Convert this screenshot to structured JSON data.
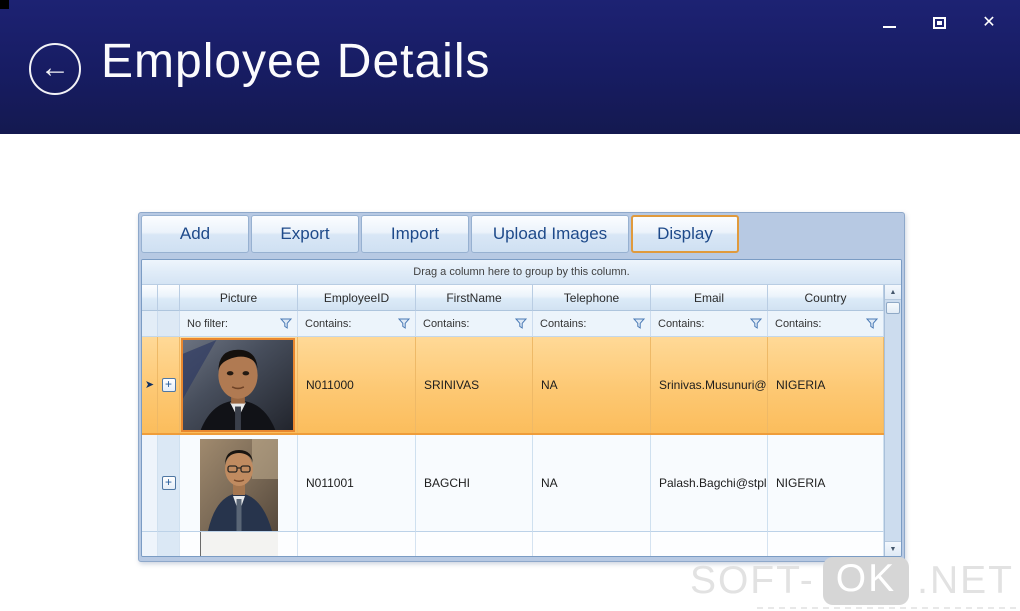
{
  "window": {
    "title": "Employee Details",
    "controls": {
      "close": "✕"
    }
  },
  "toolbar": {
    "buttons": [
      {
        "label": "Add"
      },
      {
        "label": "Export"
      },
      {
        "label": "Import"
      },
      {
        "label": "Upload Images"
      },
      {
        "label": "Display",
        "focused": true
      }
    ]
  },
  "grid": {
    "group_hint": "Drag a column here to group by this column.",
    "columns": [
      "Picture",
      "EmployeeID",
      "FirstName",
      "Telephone",
      "Email",
      "Country"
    ],
    "filters": [
      "No filter:",
      "Contains:",
      "Contains:",
      "Contains:",
      "Contains:",
      "Contains:"
    ],
    "rows": [
      {
        "picture": "portrait-man-dark-suit",
        "employee_id": "N011000",
        "first_name": "SRINIVAS",
        "telephone": "NA",
        "email": "Srinivas.Musunuri@s...",
        "country": "NIGERIA",
        "selected": true
      },
      {
        "picture": "portrait-man-glasses-navy-suit",
        "employee_id": "N011001",
        "first_name": "BAGCHI",
        "telephone": "NA",
        "email": "Palash.Bagchi@stplg...",
        "country": "NIGERIA",
        "selected": false
      }
    ],
    "partial_row_visible": true
  },
  "watermark": {
    "prefix": "SOFT-",
    "badge": "OK",
    "suffix": ".NET"
  },
  "colors": {
    "header_navy": "#171c62",
    "panel_blue": "#b7c9e3",
    "selected_row_orange": "#fbbd5c",
    "selection_border_orange": "#e8872f",
    "focused_button_border": "#e09a3c",
    "button_text_blue": "#1e4a8a"
  }
}
